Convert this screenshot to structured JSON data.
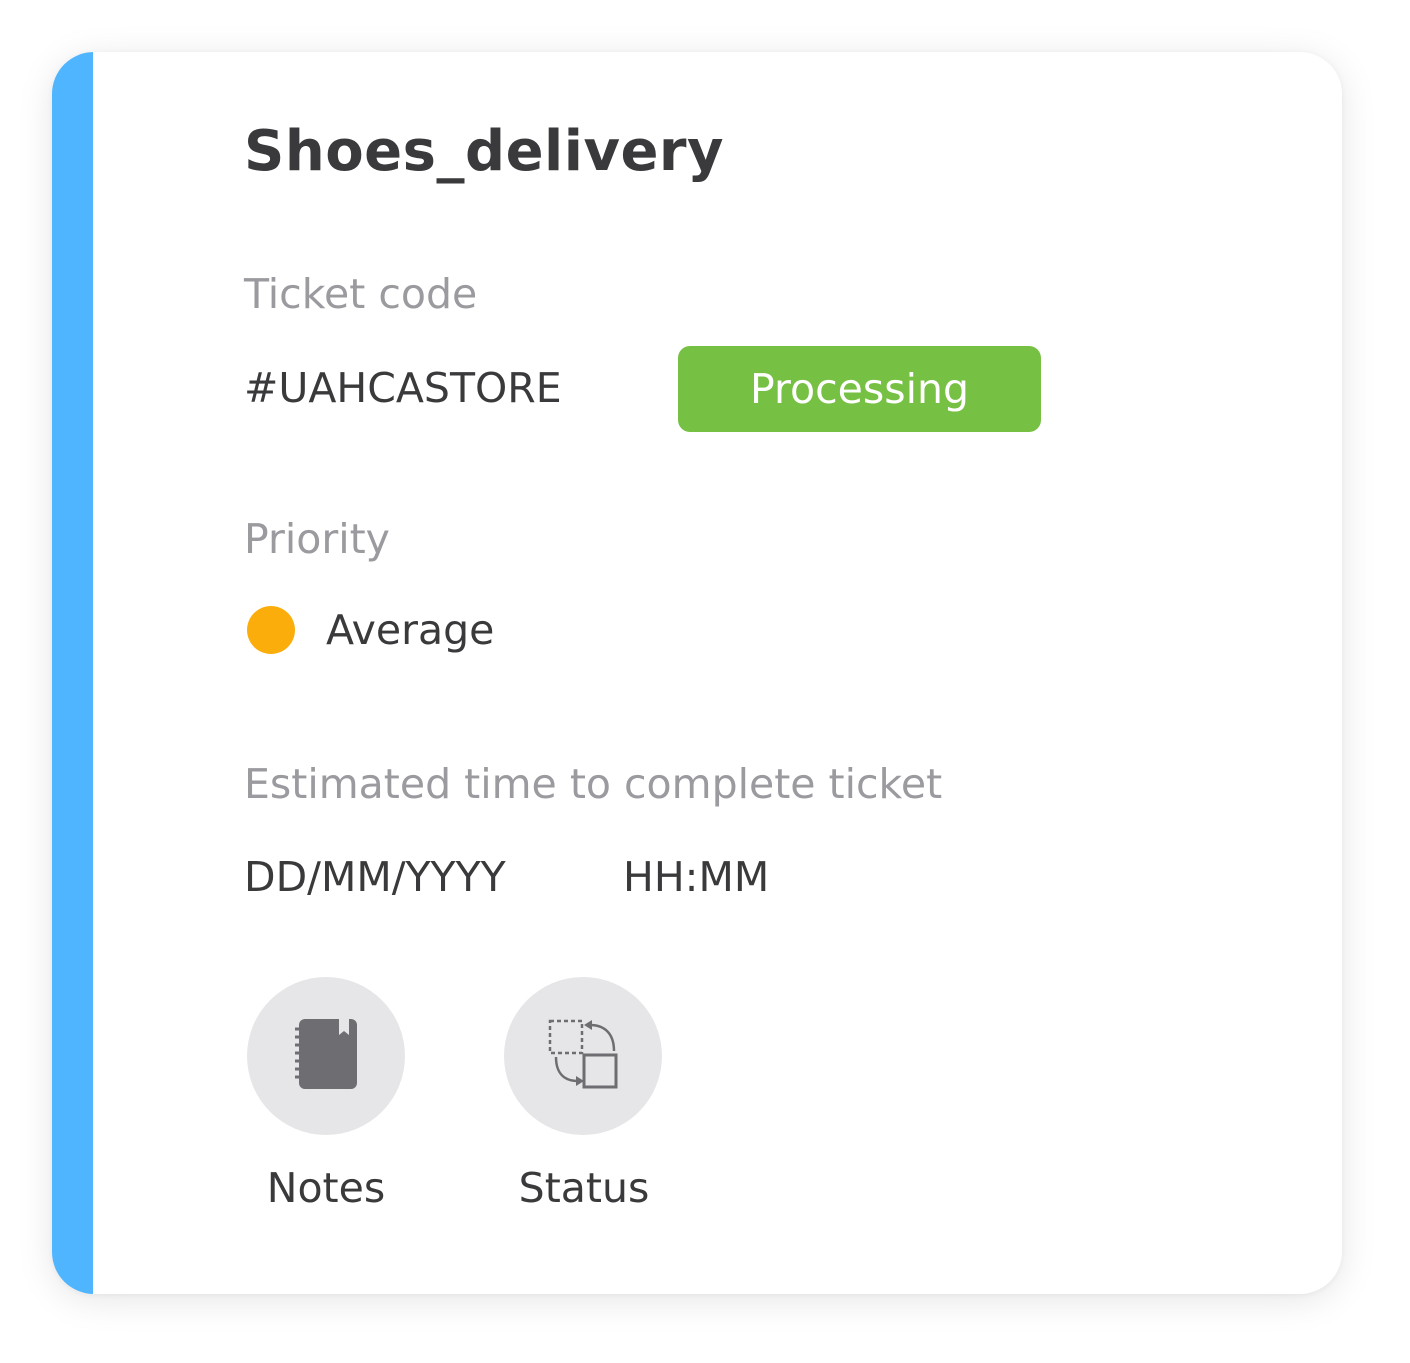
{
  "ticket": {
    "title": "Shoes_delivery",
    "code_label": "Ticket code",
    "code_value": "#UAHCASTORE",
    "status": "Processing",
    "priority_label": "Priority",
    "priority_value": "Average",
    "estimate_label": "Estimated time to complete ticket",
    "date_placeholder": "DD/MM/YYYY",
    "time_placeholder": "HH:MM"
  },
  "actions": [
    {
      "label": "Notes",
      "icon": "notebook-icon"
    },
    {
      "label": "Status",
      "icon": "swap-status-icon"
    }
  ],
  "colors": {
    "accent": "#4fb5ff",
    "status_processing": "#76c043",
    "priority_average": "#fbad0c"
  }
}
